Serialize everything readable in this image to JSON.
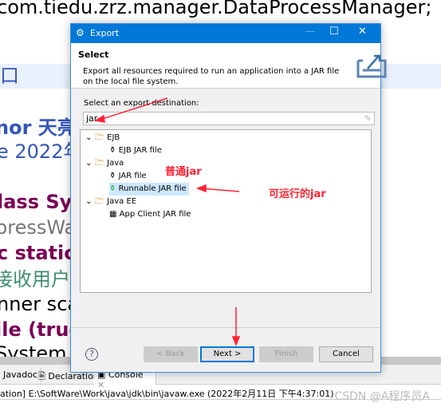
{
  "background": {
    "code_lines": [
      "com.tiedu.zrz.manager.DataProcessManager;",
      "口",
      "nor 天亮",
      "e 2022年",
      "lass Syst",
      "pressWa",
      "c static v",
      "接收用户输",
      "nner sca",
      "ile (true",
      "System"
    ],
    "tabs": [
      "Javadoc",
      "Declaration",
      "Console"
    ],
    "status": "ation] E:\\SoftWare\\Work\\java\\jdk\\bin\\javaw.exe (2022年2月11日 下午4:37:01)",
    "watermark": "CSDN @A程序员A"
  },
  "dialog": {
    "title": "Export",
    "heading": "Select",
    "description": "Export all resources required to run an application into a JAR file on the local file system.",
    "dest_label": "Select an export destination:",
    "filter_value": "jar",
    "tree": [
      {
        "label": "EJB",
        "type": "folder"
      },
      {
        "label": "EJB JAR file",
        "type": "item"
      },
      {
        "label": "Java",
        "type": "folder"
      },
      {
        "label": "JAR file",
        "type": "item"
      },
      {
        "label": "Runnable JAR file",
        "type": "item",
        "selected": true
      },
      {
        "label": "Java EE",
        "type": "folder"
      },
      {
        "label": "App Client JAR file",
        "type": "item"
      }
    ],
    "buttons": {
      "back": "< Back",
      "next": "Next >",
      "finish": "Finish",
      "cancel": "Cancel"
    }
  },
  "annotations": {
    "normal_jar": "普通jar",
    "runnable_jar": "可运行的jar"
  },
  "colors": {
    "titlebar": "#0078d7",
    "annotation": "#ff2233",
    "selection": "#cce8ff"
  }
}
